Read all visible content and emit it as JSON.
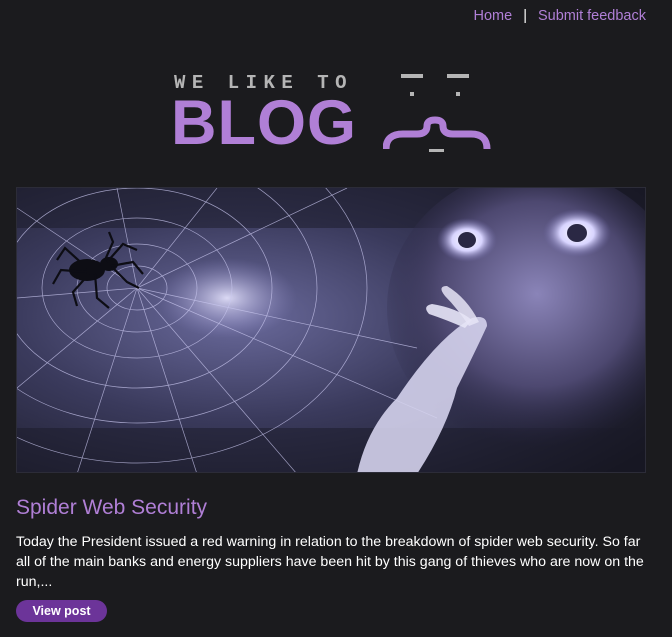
{
  "nav": {
    "home_label": "Home",
    "separator": "|",
    "feedback_label": "Submit feedback"
  },
  "logo": {
    "tagline": "WE LIKE TO",
    "word": "BLOG"
  },
  "post": {
    "title": "Spider Web Security",
    "excerpt": "Today the President issued a red warning in relation to the breakdown of spider web security. So far all of the main banks and energy suppliers have been hit by this gang of thieves who are now on the run,...",
    "button_label": "View post"
  },
  "colors": {
    "background": "#1b1b1e",
    "accent": "#b07fd6",
    "button": "#6c3499",
    "tagline": "#b5b5b5"
  }
}
